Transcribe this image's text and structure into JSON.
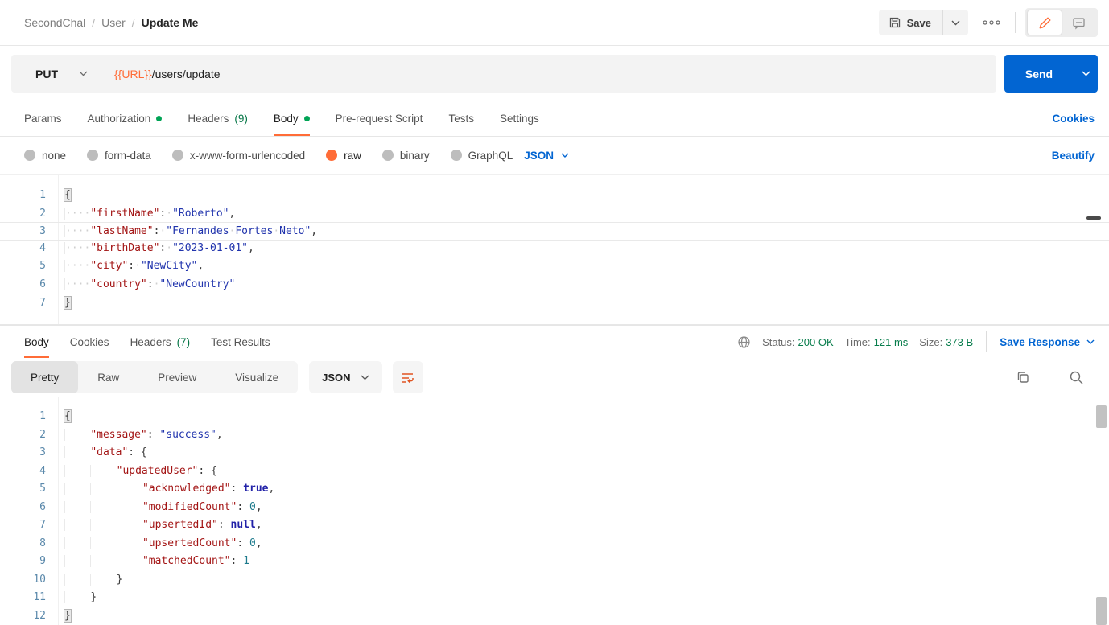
{
  "breadcrumb": {
    "collection": "SecondChal",
    "folder": "User",
    "request": "Update Me",
    "separator": "/"
  },
  "topbar": {
    "save_label": "Save"
  },
  "request_bar": {
    "method": "PUT",
    "url_variable": "{{URL}}",
    "url_path": "/users/update",
    "send_label": "Send"
  },
  "request_tabs": {
    "params": "Params",
    "authorization": "Authorization",
    "headers": "Headers",
    "headers_count": "(9)",
    "body": "Body",
    "pre_request": "Pre-request Script",
    "tests": "Tests",
    "settings": "Settings",
    "cookies_link": "Cookies"
  },
  "body_type": {
    "none": "none",
    "form_data": "form-data",
    "urlencoded": "x-www-form-urlencoded",
    "raw": "raw",
    "binary": "binary",
    "graphql": "GraphQL",
    "format": "JSON",
    "beautify_link": "Beautify"
  },
  "request_editor": {
    "lines": [
      {
        "n": 1,
        "t": [
          [
            "bh",
            "{"
          ]
        ]
      },
      {
        "n": 2,
        "t": [
          [
            "g",
            "····"
          ],
          [
            "k",
            "\"firstName\""
          ],
          [
            "p",
            ":"
          ],
          [
            "d",
            "·"
          ],
          [
            "s",
            "\"Roberto\""
          ],
          [
            "p",
            ","
          ]
        ]
      },
      {
        "n": 3,
        "cur": true,
        "t": [
          [
            "g",
            "····"
          ],
          [
            "k",
            "\"lastName\""
          ],
          [
            "p",
            ":"
          ],
          [
            "d",
            "·"
          ],
          [
            "s",
            "\"Fernandes"
          ],
          [
            "d",
            "·"
          ],
          [
            "s",
            "Fortes"
          ],
          [
            "d",
            "·"
          ],
          [
            "s",
            "Neto\""
          ],
          [
            "p",
            ","
          ]
        ]
      },
      {
        "n": 4,
        "t": [
          [
            "g",
            "····"
          ],
          [
            "k",
            "\"birthDate\""
          ],
          [
            "p",
            ":"
          ],
          [
            "d",
            "·"
          ],
          [
            "s",
            "\"2023-01-01\""
          ],
          [
            "p",
            ","
          ]
        ]
      },
      {
        "n": 5,
        "t": [
          [
            "g",
            "····"
          ],
          [
            "k",
            "\"city\""
          ],
          [
            "p",
            ":"
          ],
          [
            "d",
            "·"
          ],
          [
            "s",
            "\"NewCity\""
          ],
          [
            "p",
            ","
          ]
        ]
      },
      {
        "n": 6,
        "t": [
          [
            "g",
            "····"
          ],
          [
            "k",
            "\"country\""
          ],
          [
            "p",
            ":"
          ],
          [
            "d",
            "·"
          ],
          [
            "s",
            "\"NewCountry\""
          ]
        ]
      },
      {
        "n": 7,
        "t": [
          [
            "bh",
            "}"
          ]
        ]
      }
    ]
  },
  "response_tabs": {
    "body": "Body",
    "cookies": "Cookies",
    "headers": "Headers",
    "headers_count": "(7)",
    "test_results": "Test Results"
  },
  "response_meta": {
    "status_label": "Status:",
    "status_value": "200 OK",
    "time_label": "Time:",
    "time_value": "121 ms",
    "size_label": "Size:",
    "size_value": "373 B",
    "save_response_label": "Save Response"
  },
  "response_toolbar": {
    "views": {
      "pretty": "Pretty",
      "raw": "Raw",
      "preview": "Preview",
      "visualize": "Visualize"
    },
    "format": "JSON"
  },
  "response_editor": {
    "lines": [
      {
        "n": 1,
        "t": [
          [
            "bh",
            "{"
          ]
        ]
      },
      {
        "n": 2,
        "t": [
          [
            "g",
            "    "
          ],
          [
            "k",
            "\"message\""
          ],
          [
            "p",
            ": "
          ],
          [
            "s",
            "\"success\""
          ],
          [
            "p",
            ","
          ]
        ]
      },
      {
        "n": 3,
        "t": [
          [
            "g",
            "    "
          ],
          [
            "k",
            "\"data\""
          ],
          [
            "p",
            ": {"
          ]
        ]
      },
      {
        "n": 4,
        "t": [
          [
            "g",
            "    "
          ],
          [
            "g",
            "    "
          ],
          [
            "k",
            "\"updatedUser\""
          ],
          [
            "p",
            ": {"
          ]
        ]
      },
      {
        "n": 5,
        "t": [
          [
            "g",
            "    "
          ],
          [
            "g",
            "    "
          ],
          [
            "g",
            "    "
          ],
          [
            "k",
            "\"acknowledged\""
          ],
          [
            "p",
            ": "
          ],
          [
            "kw",
            "true"
          ],
          [
            "p",
            ","
          ]
        ]
      },
      {
        "n": 6,
        "t": [
          [
            "g",
            "    "
          ],
          [
            "g",
            "    "
          ],
          [
            "g",
            "    "
          ],
          [
            "k",
            "\"modifiedCount\""
          ],
          [
            "p",
            ": "
          ],
          [
            "n",
            "0"
          ],
          [
            "p",
            ","
          ]
        ]
      },
      {
        "n": 7,
        "t": [
          [
            "g",
            "    "
          ],
          [
            "g",
            "    "
          ],
          [
            "g",
            "    "
          ],
          [
            "k",
            "\"upsertedId\""
          ],
          [
            "p",
            ": "
          ],
          [
            "kw",
            "null"
          ],
          [
            "p",
            ","
          ]
        ]
      },
      {
        "n": 8,
        "t": [
          [
            "g",
            "    "
          ],
          [
            "g",
            "    "
          ],
          [
            "g",
            "    "
          ],
          [
            "k",
            "\"upsertedCount\""
          ],
          [
            "p",
            ": "
          ],
          [
            "n",
            "0"
          ],
          [
            "p",
            ","
          ]
        ]
      },
      {
        "n": 9,
        "t": [
          [
            "g",
            "    "
          ],
          [
            "g",
            "    "
          ],
          [
            "g",
            "    "
          ],
          [
            "k",
            "\"matchedCount\""
          ],
          [
            "p",
            ": "
          ],
          [
            "n",
            "1"
          ]
        ]
      },
      {
        "n": 10,
        "t": [
          [
            "g",
            "    "
          ],
          [
            "g",
            "    "
          ],
          [
            "p",
            "}"
          ]
        ]
      },
      {
        "n": 11,
        "t": [
          [
            "g",
            "    "
          ],
          [
            "p",
            "}"
          ]
        ]
      },
      {
        "n": 12,
        "t": [
          [
            "bh",
            "}"
          ]
        ]
      }
    ]
  },
  "colors": {
    "accent_orange": "#ff6c37",
    "link_blue": "#0265d2",
    "status_green": "#087d4c",
    "dot_green": "#00a355"
  }
}
